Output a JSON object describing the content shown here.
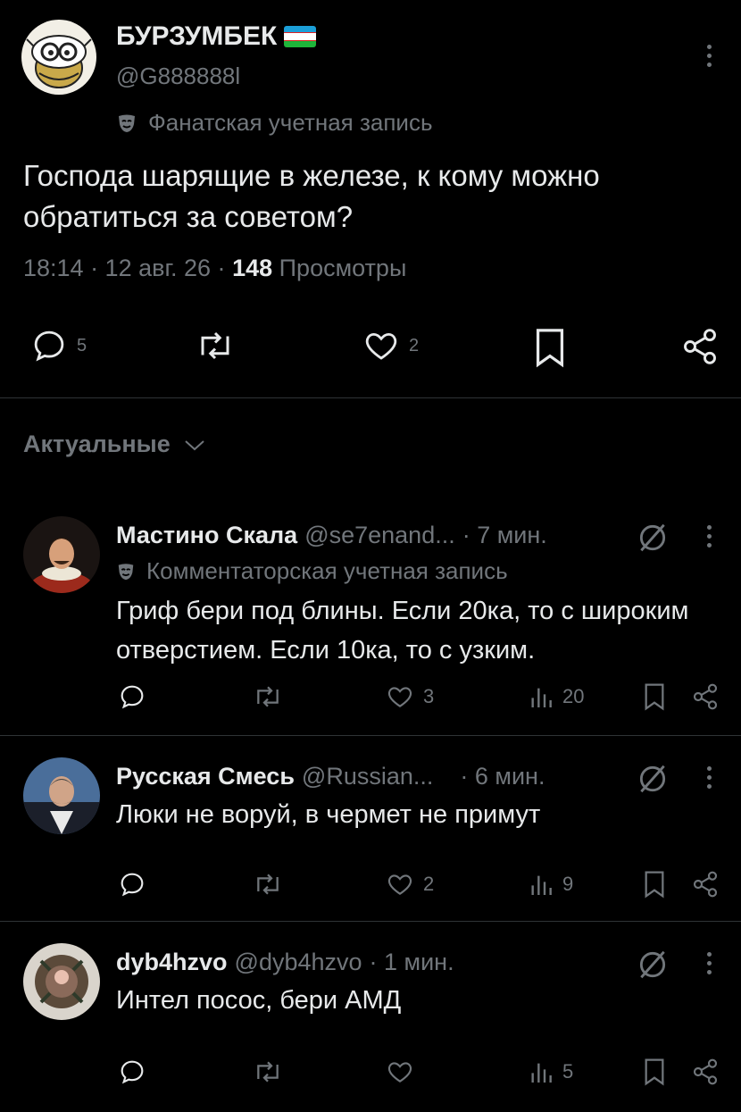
{
  "post": {
    "author_name": "БУРЗУМБЕК",
    "author_handle": "@G888888l",
    "account_label": "Фанатская учетная запись",
    "text": "Господа шарящие в железе, к кому можно обратиться за советом?",
    "time": "18:14 · 12 авг. 26 ·",
    "views_count": "148",
    "views_label": "Просмотры",
    "replies": "5",
    "likes": "2"
  },
  "sort": {
    "label": "Актуальные"
  },
  "replies": [
    {
      "name": "Мастино Скала",
      "handle": "@se7enand...",
      "time": "· 7 мин.",
      "label": "Комментаторская учетная запись",
      "text": "Гриф бери под блины. Если 20ка, то с широким отверстием. Если 10ка, то с узким.",
      "likes": "3",
      "views": "20"
    },
    {
      "name": "Русская Смесь",
      "handle": "@Russian...",
      "time": "· 6 мин.",
      "text": "Люки не воруй, в чермет не примут",
      "likes": "2",
      "views": "9"
    },
    {
      "name": "dyb4hzvo",
      "handle": "@dyb4hzvo",
      "time": "· 1 мин.",
      "text": "Интел посос, бери АМД",
      "likes": "",
      "views": "5"
    }
  ],
  "colors": {
    "background": "#000000",
    "text": "#e7e9ea",
    "muted": "#71767b",
    "divider": "#2f3336",
    "flag_blue": "#1eb53a",
    "flag_green": "#1eb53a"
  }
}
